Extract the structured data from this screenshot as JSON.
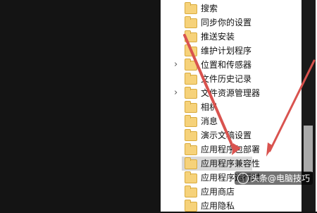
{
  "tree": {
    "items": [
      {
        "label": "搜索",
        "expandable": false
      },
      {
        "label": "同步你的设置",
        "expandable": false
      },
      {
        "label": "推送安装",
        "expandable": false
      },
      {
        "label": "维护计划程序",
        "expandable": false
      },
      {
        "label": "位置和传感器",
        "expandable": true
      },
      {
        "label": "文件历史记录",
        "expandable": false
      },
      {
        "label": "文件资源管理器",
        "expandable": true
      },
      {
        "label": "相机",
        "expandable": false
      },
      {
        "label": "消息",
        "expandable": false
      },
      {
        "label": "演示文稿设置",
        "expandable": false
      },
      {
        "label": "应用程序包部署",
        "expandable": false
      },
      {
        "label": "应用程序兼容性",
        "expandable": false,
        "selected": true
      },
      {
        "label": "应用程序运行时",
        "expandable": false
      },
      {
        "label": "应用商店",
        "expandable": false
      },
      {
        "label": "应用隐私",
        "expandable": false
      }
    ]
  },
  "watermark": {
    "text": "头条@电脑技巧",
    "icon": "watermark-logo-icon"
  },
  "colors": {
    "arrow": "#d9534f",
    "folder": "#f6d27a",
    "selected": "#d9d9d9"
  }
}
